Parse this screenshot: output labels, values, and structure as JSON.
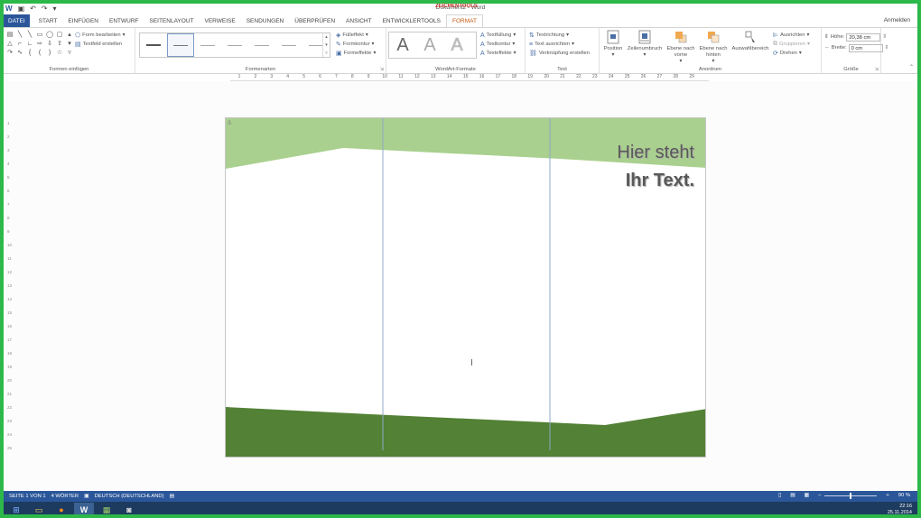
{
  "app": {
    "doc_title": "Dokument2 - Word",
    "tools_context": "ZEICHENTOOLS",
    "sign_in": "Anmelden"
  },
  "tabs": [
    "DATEI",
    "START",
    "EINFÜGEN",
    "ENTWURF",
    "SEITENLAYOUT",
    "VERWEISE",
    "SENDUNGEN",
    "ÜBERPRÜFEN",
    "ANSICHT",
    "ENTWICKLERTOOLS",
    "FORMAT"
  ],
  "ribbon": {
    "insert_shapes": {
      "label": "Formen einfügen",
      "edit_shape": "Form bearbeiten",
      "draw_textbox": "Textfeld erstellen"
    },
    "shape_styles": {
      "label": "Formenarten",
      "fill": "Fülleffekt",
      "outline": "Formkontur",
      "effects": "Formeffekte"
    },
    "wordart": {
      "label": "WordArt-Formate",
      "letters": [
        "A",
        "A",
        "A"
      ],
      "text_fill": "Textfüllung",
      "text_outline": "Textkontur",
      "text_effects": "Texteffekte"
    },
    "text": {
      "label": "Text",
      "direction": "Textrichtung",
      "align": "Text ausrichten",
      "link": "Verknüpfung erstellen"
    },
    "arrange": {
      "label": "Anordnen",
      "position": "Position",
      "wrap": "Zeilenumbruch",
      "bring_forward": "Ebene nach vorne",
      "send_backward": "Ebene nach hinten",
      "selection_pane": "Auswahlbereich",
      "align": "Ausrichten",
      "group": "Gruppieren",
      "rotate": "Drehen"
    },
    "size": {
      "label": "Größe",
      "height_label": "Höhe:",
      "height_value": "20,38 cm",
      "width_label": "Breite:",
      "width_value": "0 cm"
    }
  },
  "ruler": {
    "ticks": [
      "1",
      "2",
      "3",
      "4",
      "5",
      "6",
      "7",
      "8",
      "9",
      "10",
      "11",
      "12",
      "13",
      "14",
      "15",
      "16",
      "17",
      "18",
      "19",
      "20",
      "21",
      "22",
      "23",
      "24",
      "25",
      "26",
      "27",
      "28",
      "29"
    ],
    "vticks": [
      "1",
      "2",
      "3",
      "4",
      "5",
      "6",
      "7",
      "8",
      "9",
      "10",
      "11",
      "12",
      "13",
      "14",
      "15",
      "16",
      "17",
      "18",
      "19",
      "20",
      "21",
      "22",
      "23",
      "24",
      "25"
    ]
  },
  "document": {
    "heading_line1": "Hier steht",
    "heading_line2": "Ihr Text.",
    "colors": {
      "top_band": "#a9d08e",
      "bottom_band": "#538135",
      "guide": "#8fa8c8"
    }
  },
  "status": {
    "page": "SEITE 1 VON 1",
    "words": "4 WÖRTER",
    "language": "DEUTSCH (DEUTSCHLAND)",
    "zoom": "90 %"
  },
  "taskbar": {
    "time": "22:16",
    "date": "25.11.2014"
  }
}
